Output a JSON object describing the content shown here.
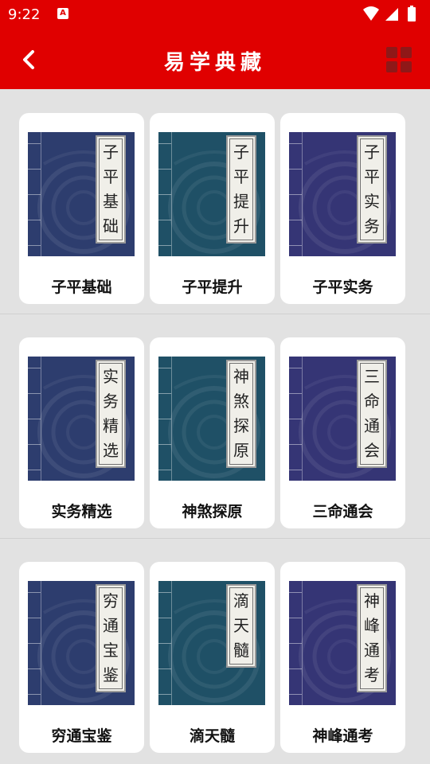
{
  "status": {
    "time": "9:22",
    "notif_badge": "A"
  },
  "appbar": {
    "title": "易学典藏"
  },
  "colors": {
    "primary_red": "#e00000",
    "cover_blue": "#2d3d6e",
    "cover_teal": "#1f5066",
    "cover_violet": "#353575"
  },
  "books": [
    {
      "title": "子平基础",
      "cover_chars": [
        "子",
        "平",
        "基",
        "础"
      ],
      "cover": "blue"
    },
    {
      "title": "子平提升",
      "cover_chars": [
        "子",
        "平",
        "提",
        "升"
      ],
      "cover": "teal"
    },
    {
      "title": "子平实务",
      "cover_chars": [
        "子",
        "平",
        "实",
        "务"
      ],
      "cover": "violet"
    },
    {
      "title": "实务精选",
      "cover_chars": [
        "实",
        "务",
        "精",
        "选"
      ],
      "cover": "blue"
    },
    {
      "title": "神煞探原",
      "cover_chars": [
        "神",
        "煞",
        "探",
        "原"
      ],
      "cover": "teal"
    },
    {
      "title": "三命通会",
      "cover_chars": [
        "三",
        "命",
        "通",
        "会"
      ],
      "cover": "violet"
    },
    {
      "title": "穷通宝鉴",
      "cover_chars": [
        "穷",
        "通",
        "宝",
        "鉴"
      ],
      "cover": "blue"
    },
    {
      "title": "滴天髓",
      "cover_chars": [
        "滴",
        "天",
        "髓"
      ],
      "cover": "teal"
    },
    {
      "title": "神峰通考",
      "cover_chars": [
        "神",
        "峰",
        "通",
        "考"
      ],
      "cover": "violet"
    }
  ]
}
